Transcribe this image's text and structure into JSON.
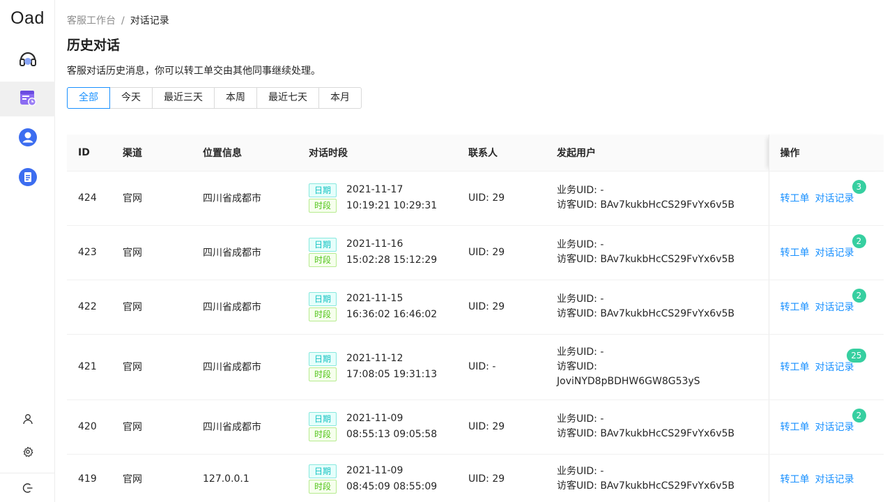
{
  "app": {
    "logo": "Oad"
  },
  "sidebar": {
    "nav": [
      {
        "name": "headset-icon",
        "color": "#5b7cfa"
      },
      {
        "name": "calendar-clock-icon",
        "color": "#7b5cf0"
      },
      {
        "name": "user-circle-icon",
        "color": "#3f6ff0"
      },
      {
        "name": "document-icon",
        "color": "#3f6ff0"
      }
    ],
    "bottom": [
      "user-icon",
      "gear-icon",
      "logout-icon"
    ]
  },
  "breadcrumb": {
    "parent": "客服工作台",
    "separator": "/",
    "current": "对话记录"
  },
  "page": {
    "title": "历史对话",
    "description": "客服对话历史消息，你可以转工单交由其他同事继续处理。"
  },
  "filters": [
    "全部",
    "今天",
    "最近三天",
    "本周",
    "最近七天",
    "本月"
  ],
  "active_filter": "全部",
  "table": {
    "columns": {
      "id": "ID",
      "channel": "渠道",
      "location": "位置信息",
      "period": "对话时段",
      "contact": "联系人",
      "user": "发起用户",
      "ops": "操作"
    },
    "tag_date": "日期",
    "tag_time": "时段",
    "action_ticket": "转工单",
    "action_history": "对话记录",
    "rows": [
      {
        "id": "424",
        "channel": "官网",
        "location": "四川省成都市",
        "date": "2021-11-17",
        "time": "10:19:21 10:29:31",
        "contact": "UID: 29",
        "biz_uid": "业务UID: -",
        "visitor_uid": "访客UID: BAv7kukbHcCS29FvYx6v5B",
        "badge": "3"
      },
      {
        "id": "423",
        "channel": "官网",
        "location": "四川省成都市",
        "date": "2021-11-16",
        "time": "15:02:28 15:12:29",
        "contact": "UID: 29",
        "biz_uid": "业务UID: -",
        "visitor_uid": "访客UID: BAv7kukbHcCS29FvYx6v5B",
        "badge": "2"
      },
      {
        "id": "422",
        "channel": "官网",
        "location": "四川省成都市",
        "date": "2021-11-15",
        "time": "16:36:02 16:46:02",
        "contact": "UID: 29",
        "biz_uid": "业务UID: -",
        "visitor_uid": "访客UID: BAv7kukbHcCS29FvYx6v5B",
        "badge": "2"
      },
      {
        "id": "421",
        "channel": "官网",
        "location": "四川省成都市",
        "date": "2021-11-12",
        "time": "17:08:05 19:31:13",
        "contact": "UID: -",
        "biz_uid": "业务UID: -",
        "visitor_uid_label": "访客UID:",
        "visitor_uid_value": "JoviNYD8pBDHW6GW8G53yS",
        "badge": "25"
      },
      {
        "id": "420",
        "channel": "官网",
        "location": "四川省成都市",
        "date": "2021-11-09",
        "time": "08:55:13 09:05:58",
        "contact": "UID: 29",
        "biz_uid": "业务UID: -",
        "visitor_uid": "访客UID: BAv7kukbHcCS29FvYx6v5B",
        "badge": "2"
      },
      {
        "id": "419",
        "channel": "官网",
        "location": "127.0.0.1",
        "date": "2021-11-09",
        "time": "08:45:09 08:55:09",
        "contact": "UID: 29",
        "biz_uid": "业务UID: -",
        "visitor_uid": "访客UID: BAv7kukbHcCS29FvYx6v5B"
      }
    ]
  },
  "colors": {
    "accent": "#1890ff",
    "badge": "#36cfa0",
    "date_tag": "#13c2c2",
    "time_tag": "#52c41a"
  }
}
